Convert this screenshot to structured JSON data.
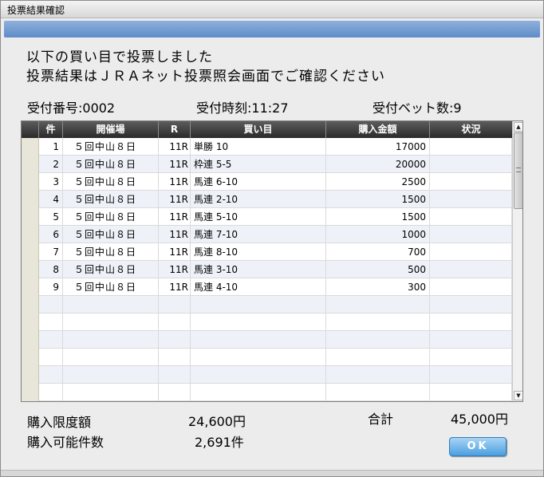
{
  "window": {
    "title": "投票結果確認"
  },
  "message": {
    "line1": "以下の買い目で投票しました",
    "line2": "投票結果はＪＲＡネット投票照会画面でご確認ください"
  },
  "info": {
    "receipt_number": "受付番号:0002",
    "receipt_time": "受付時刻:11:27",
    "bet_count": "受付ベット数:9"
  },
  "table": {
    "columns": [
      "件",
      "開催場",
      "R",
      "買い目",
      "購入金額",
      "状況"
    ],
    "rows": [
      {
        "num": "1",
        "venue": "５回中山８日",
        "race": "11R",
        "bet": "単勝 10",
        "amount": "17000",
        "status": ""
      },
      {
        "num": "2",
        "venue": "５回中山８日",
        "race": "11R",
        "bet": "枠連 5-5",
        "amount": "20000",
        "status": ""
      },
      {
        "num": "3",
        "venue": "５回中山８日",
        "race": "11R",
        "bet": "馬連 6-10",
        "amount": "2500",
        "status": ""
      },
      {
        "num": "4",
        "venue": "５回中山８日",
        "race": "11R",
        "bet": "馬連 2-10",
        "amount": "1500",
        "status": ""
      },
      {
        "num": "5",
        "venue": "５回中山８日",
        "race": "11R",
        "bet": "馬連 5-10",
        "amount": "1500",
        "status": ""
      },
      {
        "num": "6",
        "venue": "５回中山８日",
        "race": "11R",
        "bet": "馬連 7-10",
        "amount": "1000",
        "status": ""
      },
      {
        "num": "7",
        "venue": "５回中山８日",
        "race": "11R",
        "bet": "馬連 8-10",
        "amount": "700",
        "status": ""
      },
      {
        "num": "8",
        "venue": "５回中山８日",
        "race": "11R",
        "bet": "馬連 3-10",
        "amount": "500",
        "status": ""
      },
      {
        "num": "9",
        "venue": "５回中山８日",
        "race": "11R",
        "bet": "馬連 4-10",
        "amount": "300",
        "status": ""
      }
    ],
    "empty_row_count": 6
  },
  "footer": {
    "limit_label": "購入限度額",
    "limit_value": "24,600円",
    "available_label": "購入可能件数",
    "available_value": "2,691件",
    "total_label": "合計",
    "total_value": "45,000円",
    "ok_label": "OK"
  },
  "icons": {
    "scroll_up": "triangle-up-icon",
    "scroll_down": "triangle-down-icon"
  },
  "colors": {
    "accent_band": "#6a96cf",
    "ok_button": "#4a9fe0",
    "header_bg": "#3a3a3a",
    "alt_row": "#eef2f8"
  }
}
